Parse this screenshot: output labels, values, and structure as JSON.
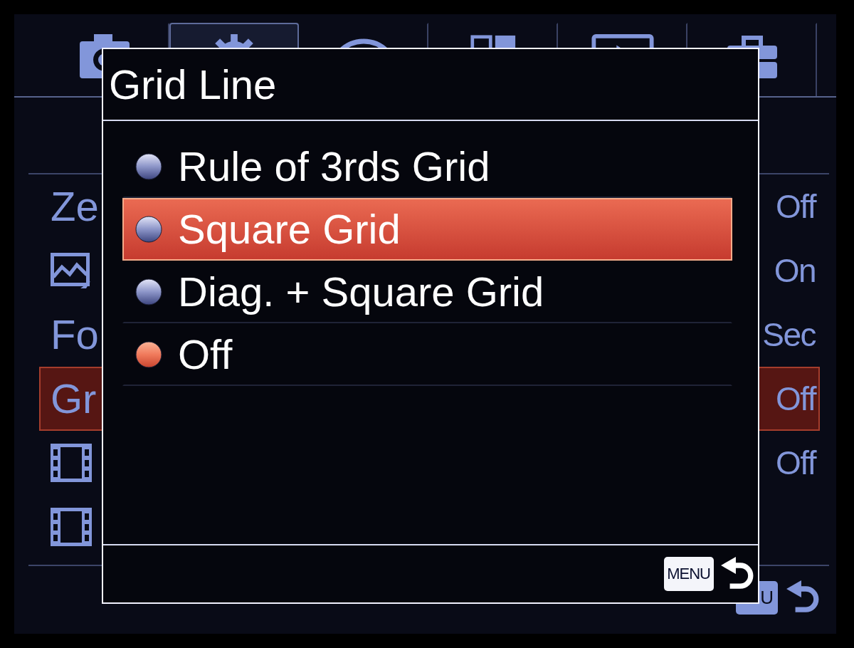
{
  "tabs": [
    {
      "kind": "camera",
      "selected": false
    },
    {
      "kind": "custom",
      "selected": true
    },
    {
      "kind": "wireless",
      "selected": false
    },
    {
      "kind": "application",
      "selected": false
    },
    {
      "kind": "playback",
      "selected": false
    },
    {
      "kind": "setup",
      "selected": false
    }
  ],
  "menu": {
    "rows": [
      {
        "kind": "text",
        "label": "Ze",
        "value": "Off",
        "selected": false
      },
      {
        "kind": "picture",
        "value": "On",
        "selected": false
      },
      {
        "kind": "text",
        "label": "Fo",
        "value": "Sec",
        "selected": false
      },
      {
        "kind": "text",
        "label": "Gr",
        "value": "Off",
        "selected": true
      },
      {
        "kind": "movie",
        "value": "Off",
        "selected": false
      },
      {
        "kind": "movie",
        "selected": false
      }
    ]
  },
  "footer": {
    "key": "U"
  },
  "dialog": {
    "title": "Grid Line",
    "options": [
      {
        "label": "Rule of 3rds Grid",
        "selected": false,
        "focused": false
      },
      {
        "label": "Square Grid",
        "selected": false,
        "focused": true
      },
      {
        "label": "Diag. + Square Grid",
        "selected": false,
        "focused": false
      },
      {
        "label": "Off",
        "selected": true,
        "focused": false
      }
    ],
    "footer": {
      "key": "MENU"
    }
  }
}
